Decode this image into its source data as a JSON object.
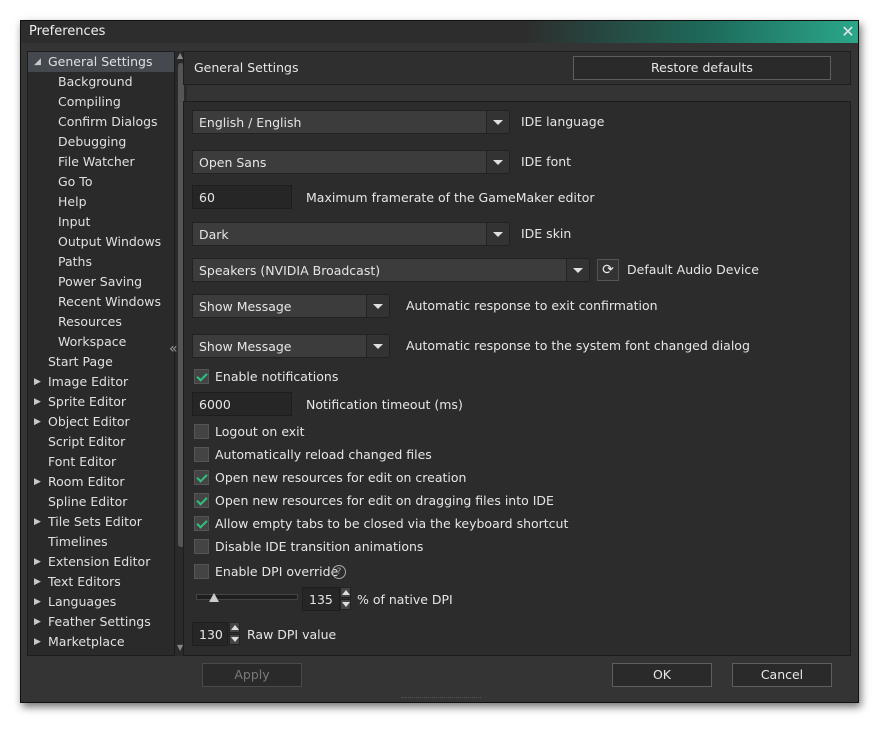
{
  "window": {
    "title": "Preferences"
  },
  "tree": [
    {
      "label": "General Settings",
      "expanded": true,
      "selected": true,
      "level": 0
    },
    {
      "label": "Background",
      "level": 1
    },
    {
      "label": "Compiling",
      "level": 1
    },
    {
      "label": "Confirm Dialogs",
      "level": 1
    },
    {
      "label": "Debugging",
      "level": 1
    },
    {
      "label": "File Watcher",
      "level": 1
    },
    {
      "label": "Go To",
      "level": 1
    },
    {
      "label": "Help",
      "level": 1
    },
    {
      "label": "Input",
      "level": 1
    },
    {
      "label": "Output Windows",
      "level": 1
    },
    {
      "label": "Paths",
      "level": 1
    },
    {
      "label": "Power Saving",
      "level": 1
    },
    {
      "label": "Recent Windows",
      "level": 1
    },
    {
      "label": "Resources",
      "level": 1
    },
    {
      "label": "Workspace",
      "level": 1
    },
    {
      "label": "Start Page",
      "level": 0
    },
    {
      "label": "Image Editor",
      "level": 0,
      "collapsed": true
    },
    {
      "label": "Sprite Editor",
      "level": 0,
      "collapsed": true
    },
    {
      "label": "Object Editor",
      "level": 0,
      "collapsed": true
    },
    {
      "label": "Script Editor",
      "level": 0
    },
    {
      "label": "Font Editor",
      "level": 0
    },
    {
      "label": "Room Editor",
      "level": 0,
      "collapsed": true
    },
    {
      "label": "Spline Editor",
      "level": 0
    },
    {
      "label": "Tile Sets Editor",
      "level": 0,
      "collapsed": true
    },
    {
      "label": "Timelines",
      "level": 0
    },
    {
      "label": "Extension Editor",
      "level": 0,
      "collapsed": true
    },
    {
      "label": "Text Editors",
      "level": 0,
      "collapsed": true
    },
    {
      "label": "Languages",
      "level": 0,
      "collapsed": true
    },
    {
      "label": "Feather Settings",
      "level": 0,
      "collapsed": true
    },
    {
      "label": "Marketplace",
      "level": 0,
      "collapsed": true
    }
  ],
  "header": {
    "title": "General Settings",
    "restore": "Restore defaults"
  },
  "settings": {
    "language": {
      "value": "English / English",
      "label": "IDE language"
    },
    "font": {
      "value": "Open Sans",
      "label": "IDE font"
    },
    "framerate": {
      "value": "60",
      "label": "Maximum framerate of the GameMaker editor"
    },
    "skin": {
      "value": "Dark",
      "label": "IDE skin"
    },
    "audio": {
      "value": "Speakers (NVIDIA Broadcast)",
      "label": "Default Audio Device"
    },
    "exit_response": {
      "value": "Show Message",
      "label": "Automatic response to exit confirmation"
    },
    "font_response": {
      "value": "Show Message",
      "label": "Automatic response to the system font changed dialog"
    },
    "notifications": {
      "label": "Enable notifications",
      "checked": true
    },
    "timeout": {
      "value": "6000",
      "label": "Notification timeout (ms)"
    },
    "checks": [
      {
        "label": "Logout on exit",
        "checked": false
      },
      {
        "label": "Automatically reload changed files",
        "checked": false
      },
      {
        "label": "Open new resources for edit on creation",
        "checked": true
      },
      {
        "label": "Open new resources for edit on dragging files into IDE",
        "checked": true
      },
      {
        "label": "Allow empty tabs to be closed via the keyboard shortcut",
        "checked": true
      },
      {
        "label": "Disable IDE transition animations",
        "checked": false
      }
    ],
    "dpi_override": {
      "label": "Enable DPI override",
      "checked": false
    },
    "dpi_percent": {
      "value": "135",
      "label": "% of native DPI"
    },
    "raw_dpi": {
      "value": "130",
      "label": "Raw DPI value"
    }
  },
  "footer": {
    "apply": "Apply",
    "ok": "OK",
    "cancel": "Cancel"
  }
}
